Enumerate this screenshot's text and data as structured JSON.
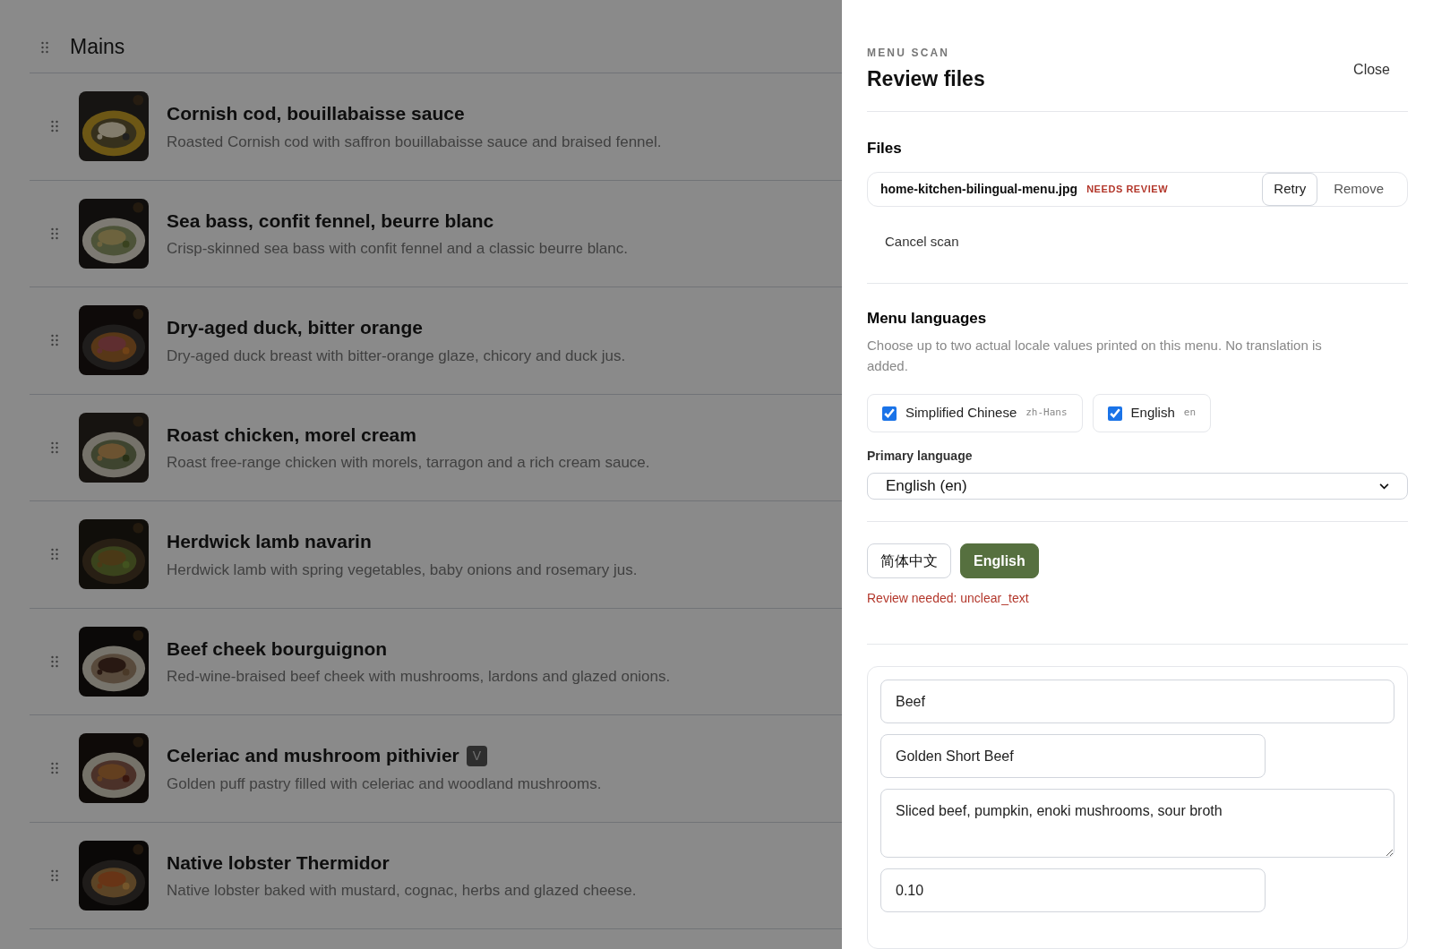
{
  "section": {
    "title": "Mains"
  },
  "dishes": [
    {
      "name": "Cornish cod, bouillabaisse sauce",
      "description": "Roasted Cornish cod with saffron bouillabaisse sauce and braised fennel."
    },
    {
      "name": "Sea bass, confit fennel, beurre blanc",
      "description": "Crisp-skinned sea bass with confit fennel and a classic beurre blanc."
    },
    {
      "name": "Dry-aged duck, bitter orange",
      "description": "Dry-aged duck breast with bitter-orange glaze, chicory and duck jus."
    },
    {
      "name": "Roast chicken, morel cream",
      "description": "Roast free-range chicken with morels, tarragon and a rich cream sauce."
    },
    {
      "name": "Herdwick lamb navarin",
      "description": "Herdwick lamb with spring vegetables, baby onions and rosemary jus."
    },
    {
      "name": "Beef cheek bourguignon",
      "description": "Red-wine-braised beef cheek with mushrooms, lardons and glazed onions."
    },
    {
      "name": "Celeriac and mushroom pithivier",
      "badge": "V",
      "description": "Golden puff pastry filled with celeriac and woodland mushrooms."
    },
    {
      "name": "Native lobster Thermidor",
      "description": "Native lobster baked with mustard, cognac, herbs and glazed cheese."
    }
  ],
  "drawer": {
    "eyebrow": "MENU SCAN",
    "title": "Review files",
    "close": "Close",
    "files_heading": "Files",
    "files": [
      {
        "name": "home-kitchen-bilingual-menu.jpg",
        "status": "NEEDS REVIEW",
        "retry": "Retry",
        "remove": "Remove"
      }
    ],
    "cancel": "Cancel scan",
    "languages_heading": "Menu languages",
    "languages_help": "Choose up to two actual locale values printed on this menu. No translation is added.",
    "languages": [
      {
        "label": "Simplified Chinese",
        "code": "zh-Hans",
        "checked": true
      },
      {
        "label": "English",
        "code": "en",
        "checked": true
      }
    ],
    "primary_label": "Primary language",
    "primary_value": "English (en)",
    "language_tabs": [
      {
        "label": "简体中文",
        "selected": false
      },
      {
        "label": "English",
        "selected": true
      }
    ],
    "review_note": "Review needed: unclear_text",
    "item_fields": [
      {
        "kind": "wide",
        "value": "Beef"
      },
      {
        "kind": "narrow",
        "value": "Golden Short Beef"
      },
      {
        "kind": "area",
        "value": "Sliced beef, pumpkin, enoki mushrooms, sour broth"
      },
      {
        "kind": "narrow",
        "value": "0.10"
      }
    ]
  }
}
